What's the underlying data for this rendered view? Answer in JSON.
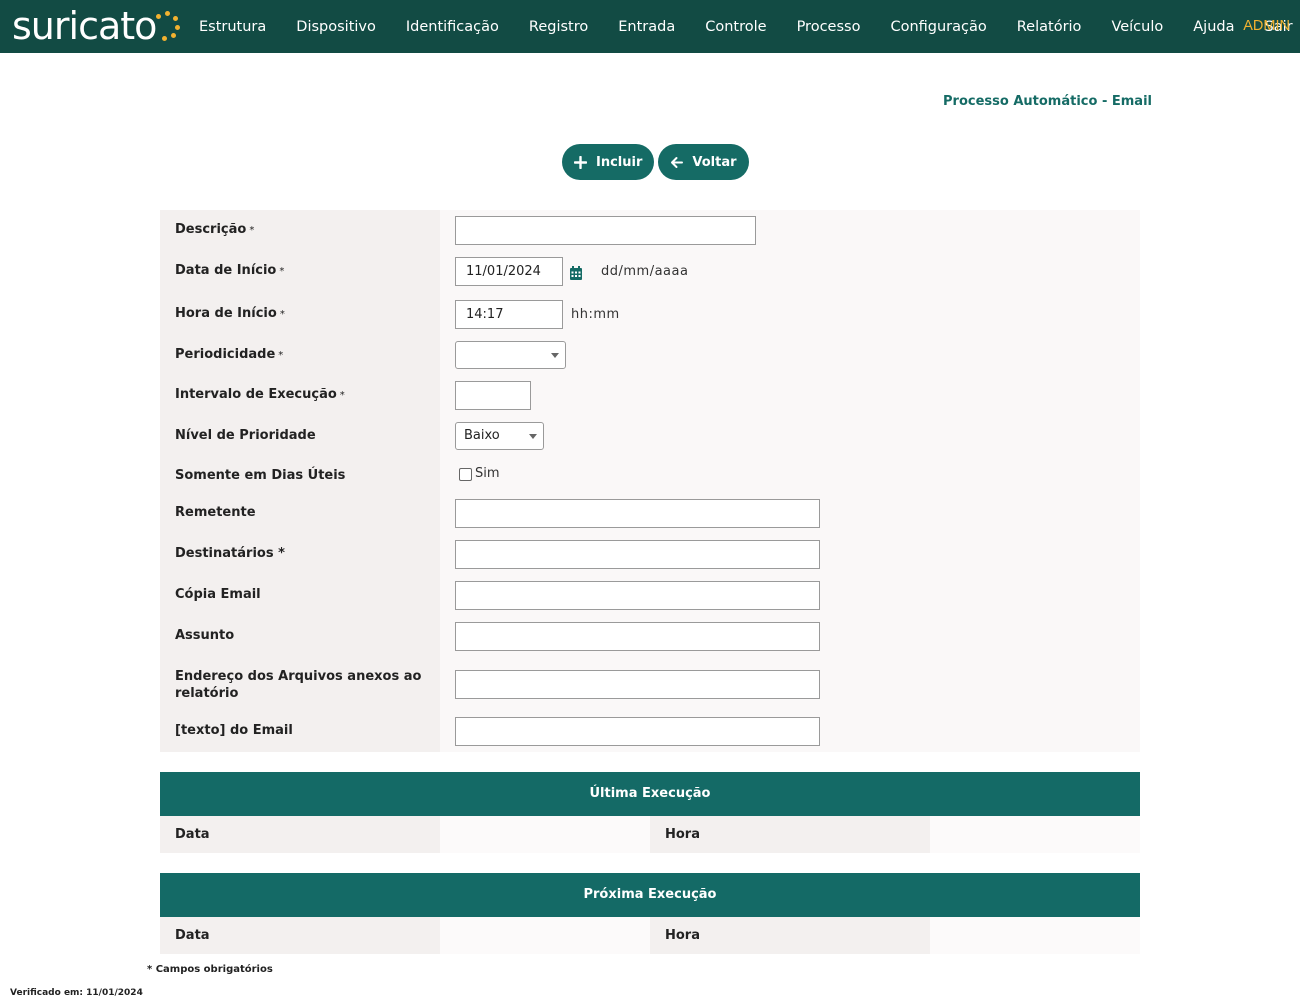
{
  "brand": {
    "logo_text": "suricato",
    "accent": "#f2b230",
    "header_bg": "#124b44",
    "primary": "#156b65"
  },
  "nav": {
    "items": [
      "Estrutura",
      "Dispositivo",
      "Identificação",
      "Registro",
      "Entrada",
      "Controle",
      "Processo",
      "Configuração",
      "Relatório",
      "Veículo",
      "Ajuda",
      "Sair"
    ],
    "user": "ADMIN"
  },
  "page": {
    "title": "Processo Automático - Email"
  },
  "toolbar": {
    "include_label": "Incluir",
    "back_label": "Voltar"
  },
  "form": {
    "descricao": {
      "label": "Descrição",
      "value": ""
    },
    "data_inicio": {
      "label": "Data de Início",
      "value": "11/01/2024",
      "hint": "dd/mm/aaaa"
    },
    "hora_inicio": {
      "label": "Hora de Início",
      "value": "14:17",
      "hint": "hh:mm"
    },
    "periodicidade": {
      "label": "Periodicidade",
      "value": ""
    },
    "intervalo": {
      "label": "Intervalo de Execução",
      "value": ""
    },
    "prioridade": {
      "label": "Nível de Prioridade",
      "value": "Baixo"
    },
    "dias_uteis": {
      "label": "Somente em Dias Úteis",
      "option": "Sim",
      "checked": false
    },
    "remetente": {
      "label": "Remetente",
      "value": ""
    },
    "destinatarios": {
      "label": "Destinatários *",
      "value": ""
    },
    "copia": {
      "label": "Cópia Email",
      "value": ""
    },
    "assunto": {
      "label": "Assunto",
      "value": ""
    },
    "anexos": {
      "label": "Endereço dos Arquivos anexos ao relatório",
      "value": ""
    },
    "texto": {
      "label": "[texto] do Email",
      "value": ""
    },
    "required_mark": "*"
  },
  "ultima": {
    "title": "Última Execução",
    "data_label": "Data",
    "hora_label": "Hora"
  },
  "proxima": {
    "title": "Próxima Execução",
    "data_label": "Data",
    "hora_label": "Hora"
  },
  "footer": {
    "required_note": "* Campos obrigatórios",
    "verified": "Verificado em: 11/01/2024"
  }
}
